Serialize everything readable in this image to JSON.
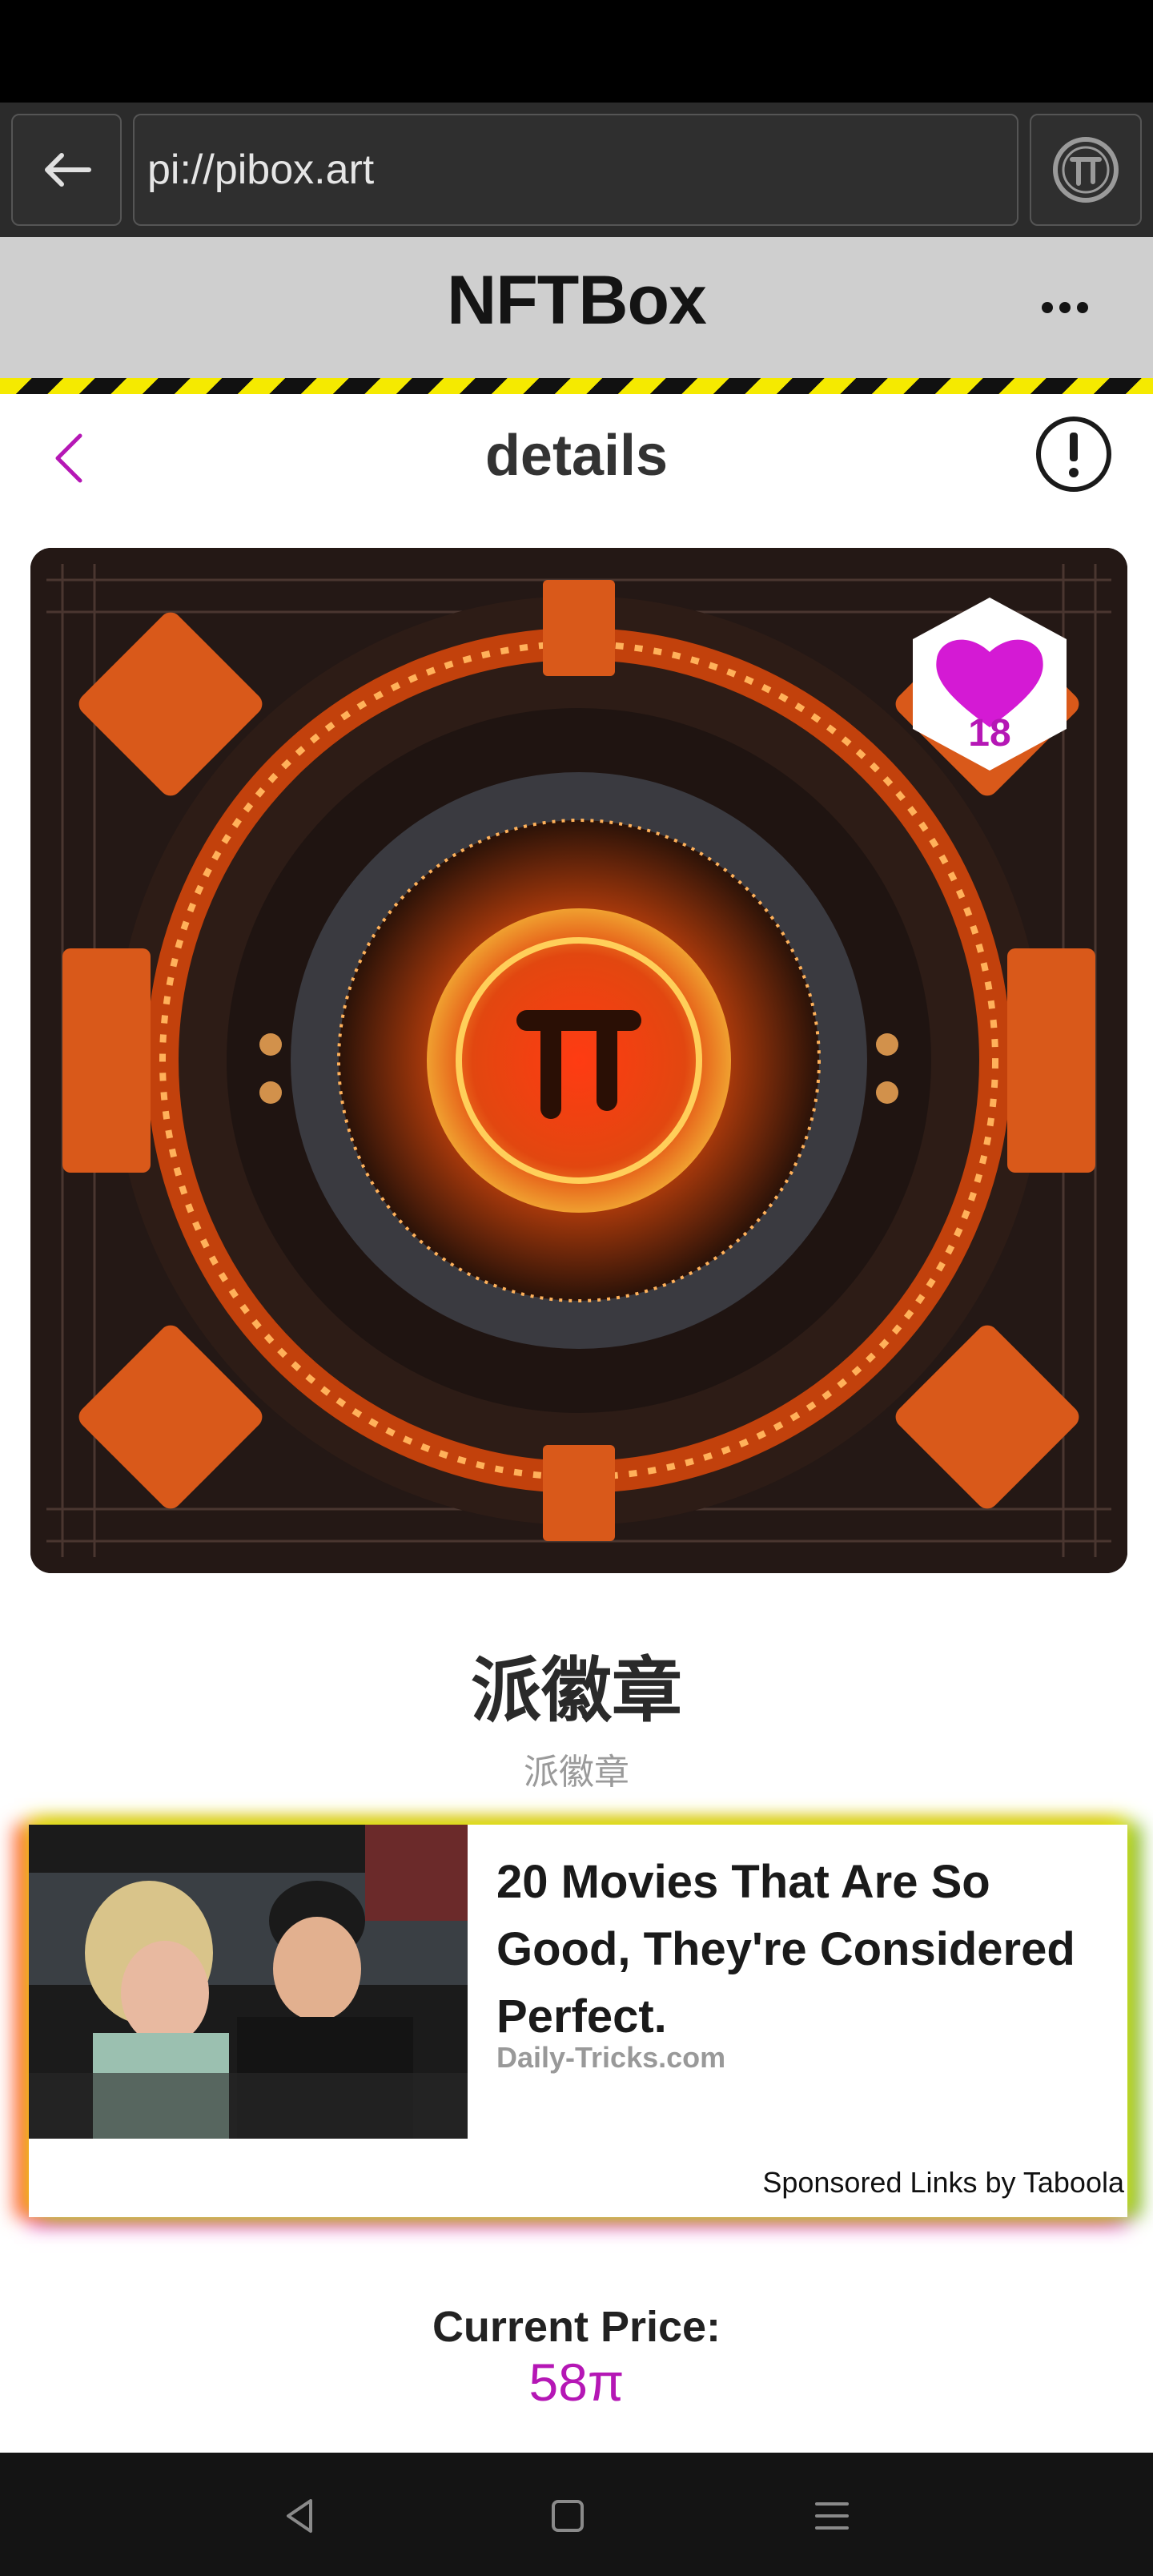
{
  "browser": {
    "url": "pi://pibox.art"
  },
  "header": {
    "title": "NFTBox"
  },
  "details": {
    "title": "details"
  },
  "nft": {
    "likes": "18",
    "name": "派徽章",
    "subname": "派徽章"
  },
  "ad": {
    "headline": "20 Movies That Are So Good, They're Considered Perfect.",
    "source": "Daily-Tricks.com",
    "sponsor": "Sponsored Links by Taboola"
  },
  "price": {
    "label": "Current Price:",
    "value": "58π"
  },
  "colors": {
    "accent": "#b517b5",
    "hazard_yellow": "#f5ea00",
    "header_bg": "#cfcfcf"
  },
  "icons": [
    "back-arrow-icon",
    "pi-logo-icon",
    "more-dots-icon",
    "chevron-left-icon",
    "info-icon",
    "heart-icon",
    "nav-back-icon",
    "nav-home-icon",
    "nav-menu-icon"
  ]
}
